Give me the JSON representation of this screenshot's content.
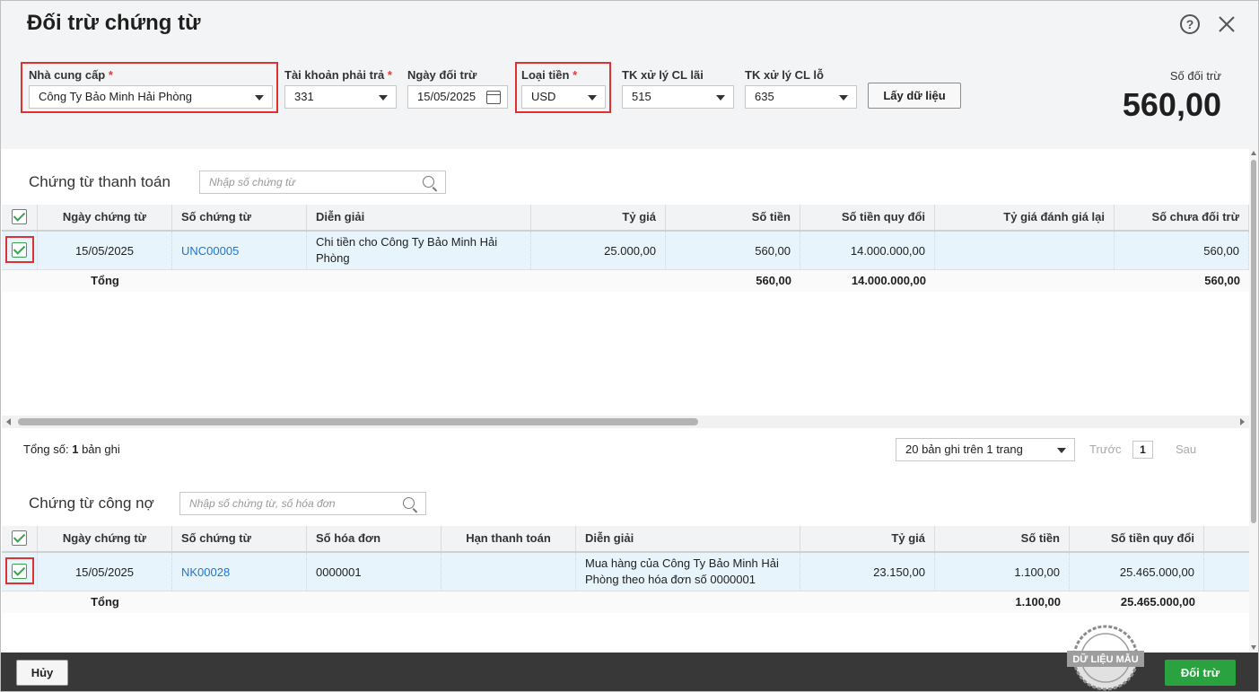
{
  "dialog": {
    "title": "Đối trừ chứng từ"
  },
  "icons": {
    "help": "help-circle-icon",
    "close": "close-icon",
    "calendar": "calendar-icon",
    "search": "search-icon",
    "dropdown": "chevron-down-icon",
    "checkbox": "check-icon"
  },
  "colors": {
    "highlight_border": "#e03131",
    "link": "#1b76d2",
    "primary_button": "#2aa23f",
    "checkbox": "#3aa14f",
    "footer": "#383838"
  },
  "filters": {
    "supplier": {
      "label": "Nhà cung cấp",
      "required": "*",
      "value": "Công Ty Bảo Minh Hải Phòng"
    },
    "payable_account": {
      "label": "Tài khoản phải trả",
      "required": "*",
      "value": "331"
    },
    "offset_date": {
      "label": "Ngày đối trừ",
      "value": "15/05/2025"
    },
    "currency": {
      "label": "Loại tiền",
      "required": "*",
      "value": "USD"
    },
    "gain_account": {
      "label": "TK xử lý CL lãi",
      "value": "515"
    },
    "loss_account": {
      "label": "TK xử lý CL lỗ",
      "value": "635"
    },
    "fetch_button": "Lấy dữ liệu"
  },
  "offset_summary": {
    "label": "Số đối trừ",
    "value": "560,00"
  },
  "payment_section": {
    "title": "Chứng từ thanh toán",
    "search_placeholder": "Nhập số chứng từ",
    "columns": [
      "Ngày chứng từ",
      "Số chứng từ",
      "Diễn giải",
      "Tỷ giá",
      "Số tiền",
      "Số tiền quy đổi",
      "Tỷ giá đánh giá lại",
      "Số chưa đối trừ"
    ],
    "rows": [
      {
        "date": "15/05/2025",
        "doc_no": "UNC00005",
        "description": "Chi tiền cho Công Ty Bảo Minh Hải Phòng",
        "rate": "25.000,00",
        "amount": "560,00",
        "converted": "14.000.000,00",
        "revalued_rate": "",
        "unoffset": "560,00"
      }
    ],
    "totals": {
      "label": "Tổng",
      "amount": "560,00",
      "converted": "14.000.000,00",
      "unoffset": "560,00"
    }
  },
  "pagination": {
    "total_prefix": "Tổng số:",
    "total_count": "1",
    "total_suffix": "bản ghi",
    "page_size": "20 bản ghi trên 1 trang",
    "prev": "Trước",
    "page": "1",
    "next": "Sau"
  },
  "debt_section": {
    "title": "Chứng từ công nợ",
    "search_placeholder": "Nhập số chứng từ, số hóa đơn",
    "columns": [
      "Ngày chứng từ",
      "Số chứng từ",
      "Số hóa đơn",
      "Hạn thanh toán",
      "Diễn giải",
      "Tỷ giá",
      "Số tiền",
      "Số tiền quy đổi"
    ],
    "rows": [
      {
        "date": "15/05/2025",
        "doc_no": "NK00028",
        "invoice_no": "0000001",
        "due_date": "",
        "description": "Mua hàng của Công Ty Bảo Minh Hải Phòng theo hóa đơn số 0000001",
        "rate": "23.150,00",
        "amount": "1.100,00",
        "converted": "25.465.000,00"
      }
    ],
    "totals": {
      "label": "Tổng",
      "amount": "1.100,00",
      "converted": "25.465.000,00"
    }
  },
  "footer": {
    "cancel": "Hủy",
    "offset": "Đối trừ"
  },
  "watermark": {
    "text": "DỮ LIỆU MẪU"
  }
}
